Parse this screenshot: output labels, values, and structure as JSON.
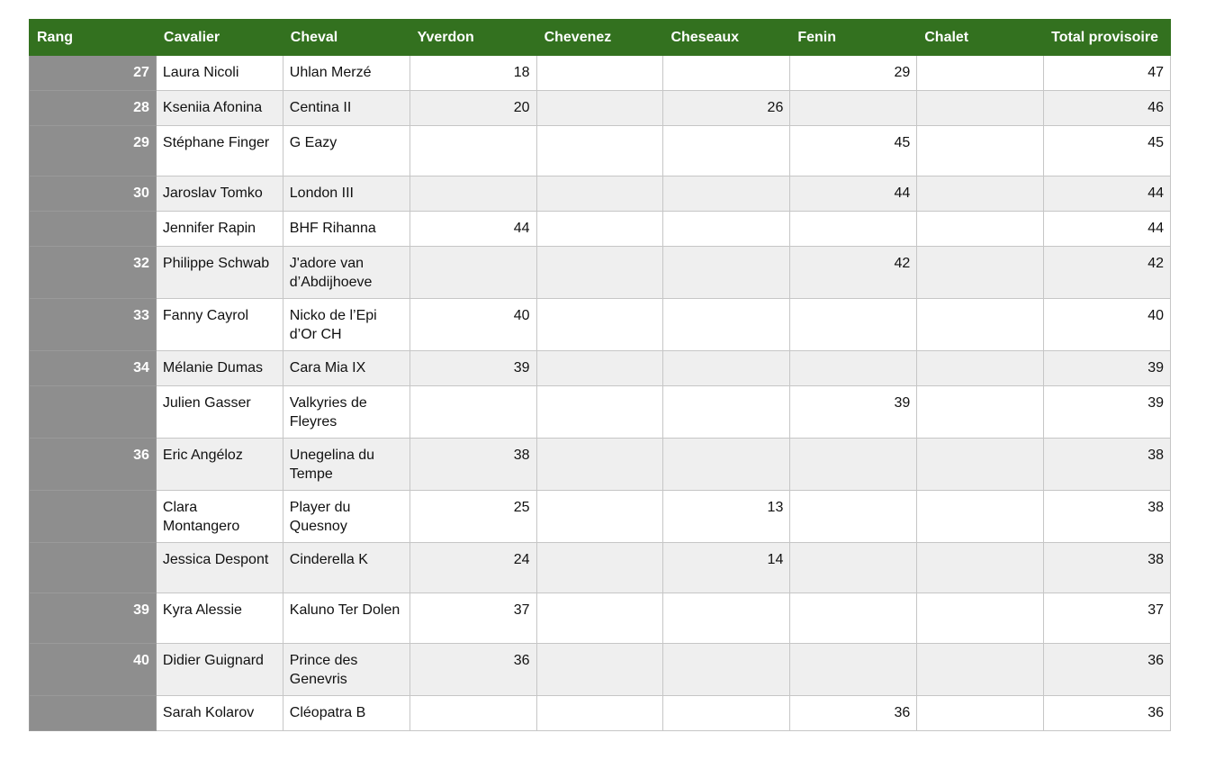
{
  "table": {
    "headers": [
      "Rang",
      "Cavalier",
      "Cheval",
      "Yverdon",
      "Chevenez",
      "Cheseaux",
      "Fenin",
      "Chalet",
      "Total provisoire"
    ],
    "rows": [
      {
        "rang": "27",
        "cavalier": "Laura Nicoli",
        "cheval": "Uhlan Merzé",
        "yverdon": "18",
        "chevenez": "",
        "cheseaux": "",
        "fenin": "29",
        "chalet": "",
        "total": "47"
      },
      {
        "rang": "28",
        "cavalier": "Kseniia Afonina",
        "cheval": "Centina II",
        "yverdon": "20",
        "chevenez": "",
        "cheseaux": "26",
        "fenin": "",
        "chalet": "",
        "total": "46"
      },
      {
        "rang": "29",
        "cavalier": "Stéphane Finger",
        "cheval": "G Eazy",
        "yverdon": "",
        "chevenez": "",
        "cheseaux": "",
        "fenin": "45",
        "chalet": "",
        "total": "45"
      },
      {
        "rang": "30",
        "cavalier": "Jaroslav Tomko",
        "cheval": "London III",
        "yverdon": "",
        "chevenez": "",
        "cheseaux": "",
        "fenin": "44",
        "chalet": "",
        "total": "44"
      },
      {
        "rang": "",
        "cavalier": "Jennifer Rapin",
        "cheval": "BHF Rihanna",
        "yverdon": "44",
        "chevenez": "",
        "cheseaux": "",
        "fenin": "",
        "chalet": "",
        "total": "44"
      },
      {
        "rang": "32",
        "cavalier": "Philippe Schwab",
        "cheval": "J'adore van d’Abdijhoeve",
        "yverdon": "",
        "chevenez": "",
        "cheseaux": "",
        "fenin": "42",
        "chalet": "",
        "total": "42"
      },
      {
        "rang": "33",
        "cavalier": "Fanny Cayrol",
        "cheval": "Nicko de l’Epi d’Or CH",
        "yverdon": "40",
        "chevenez": "",
        "cheseaux": "",
        "fenin": "",
        "chalet": "",
        "total": "40"
      },
      {
        "rang": "34",
        "cavalier": "Mélanie Dumas",
        "cheval": "Cara Mia IX",
        "yverdon": "39",
        "chevenez": "",
        "cheseaux": "",
        "fenin": "",
        "chalet": "",
        "total": "39"
      },
      {
        "rang": "",
        "cavalier": "Julien Gasser",
        "cheval": "Valkyries de Fleyres",
        "yverdon": "",
        "chevenez": "",
        "cheseaux": "",
        "fenin": "39",
        "chalet": "",
        "total": "39"
      },
      {
        "rang": "36",
        "cavalier": "Eric Angéloz",
        "cheval": "Unegelina du Tempe",
        "yverdon": "38",
        "chevenez": "",
        "cheseaux": "",
        "fenin": "",
        "chalet": "",
        "total": "38"
      },
      {
        "rang": "",
        "cavalier": "Clara Montangero",
        "cheval": "Player du Quesnoy",
        "yverdon": "25",
        "chevenez": "",
        "cheseaux": "13",
        "fenin": "",
        "chalet": "",
        "total": "38"
      },
      {
        "rang": "",
        "cavalier": "Jessica Despont",
        "cheval": "Cinderella K",
        "yverdon": "24",
        "chevenez": "",
        "cheseaux": "14",
        "fenin": "",
        "chalet": "",
        "total": "38"
      },
      {
        "rang": "39",
        "cavalier": "Kyra Alessie",
        "cheval": "Kaluno Ter Dolen",
        "yverdon": "37",
        "chevenez": "",
        "cheseaux": "",
        "fenin": "",
        "chalet": "",
        "total": "37"
      },
      {
        "rang": "40",
        "cavalier": "Didier Guignard",
        "cheval": "Prince des Genevris",
        "yverdon": "36",
        "chevenez": "",
        "cheseaux": "",
        "fenin": "",
        "chalet": "",
        "total": "36"
      },
      {
        "rang": "",
        "cavalier": "Sarah Kolarov",
        "cheval": "Cléopatra B",
        "yverdon": "",
        "chevenez": "",
        "cheseaux": "",
        "fenin": "36",
        "chalet": "",
        "total": "36"
      }
    ]
  },
  "colors": {
    "header_bg": "#33711f",
    "rank_bg": "#8e8e8e",
    "row_alt_bg": "#efefef"
  }
}
